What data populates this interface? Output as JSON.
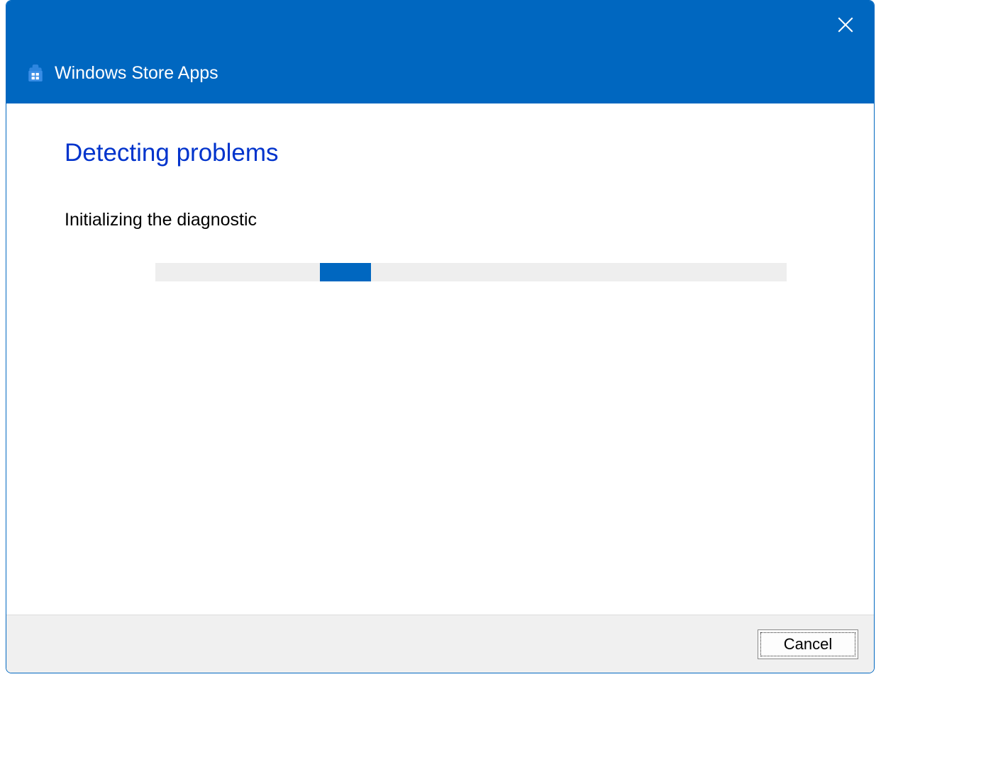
{
  "titlebar": {
    "title": "Windows Store Apps"
  },
  "content": {
    "heading": "Detecting problems",
    "status": "Initializing the diagnostic"
  },
  "footer": {
    "cancel_label": "Cancel"
  },
  "colors": {
    "accent": "#0067c0",
    "heading": "#0033cc",
    "footer_bg": "#f0f0f0",
    "track": "#eeeeee"
  }
}
